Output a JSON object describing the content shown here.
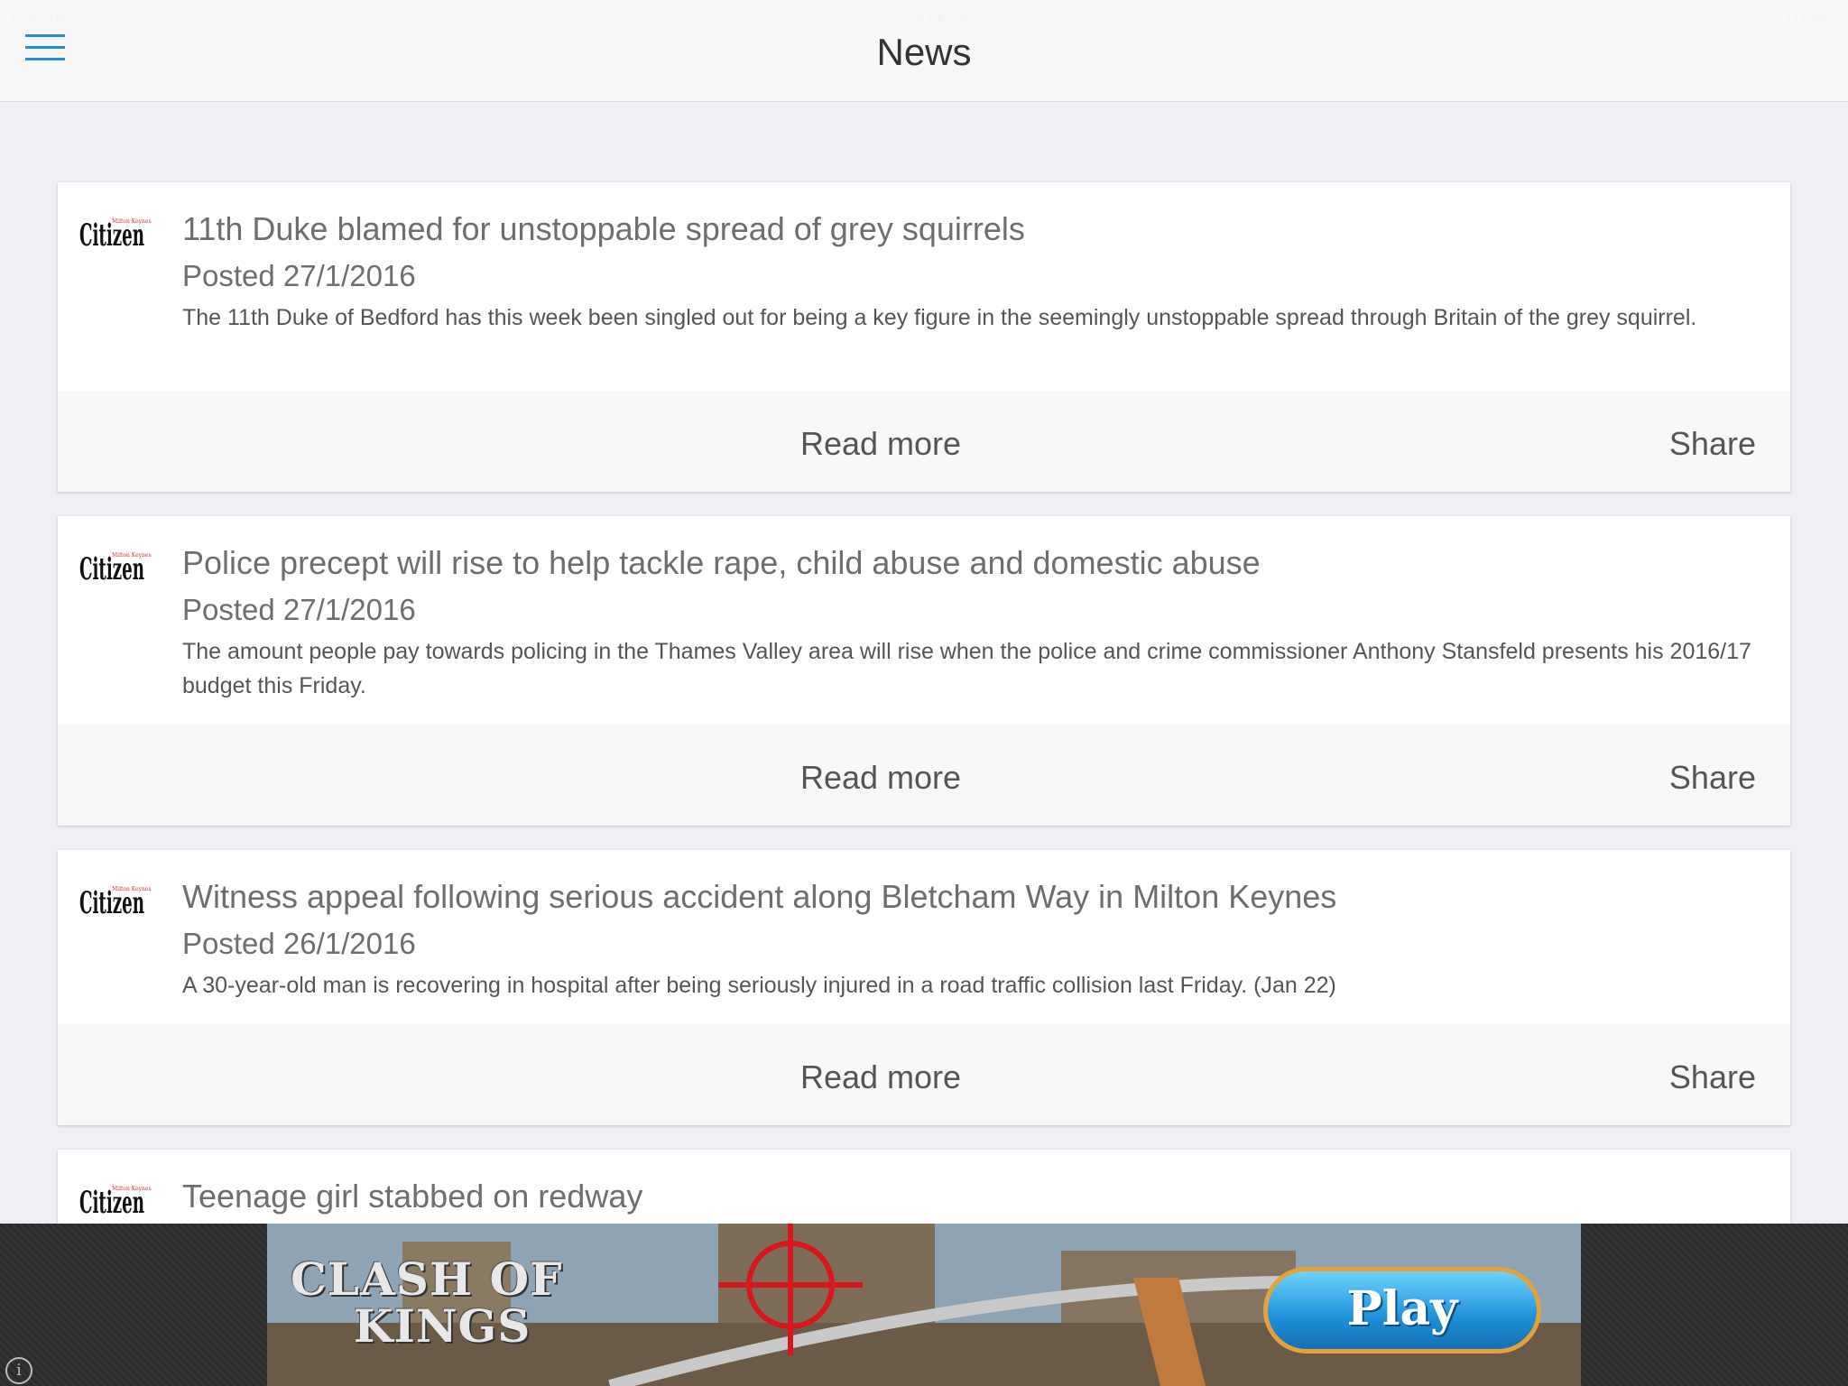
{
  "status_bar": {
    "carrier": "Carrier",
    "time": "12:20 PM",
    "battery": "100%"
  },
  "nav": {
    "title": "News"
  },
  "articles": [
    {
      "source": "Citizen",
      "source_tagline": "Milton Keynes",
      "title": "11th Duke blamed for unstoppable spread of grey squirrels",
      "posted": "Posted 27/1/2016",
      "summary": "The 11th Duke of Bedford has this week been singled out for being a key figure in the seemingly unstoppable spread through Britain of the grey squirrel.",
      "read_more": "Read more",
      "share": "Share"
    },
    {
      "source": "Citizen",
      "source_tagline": "Milton Keynes",
      "title": "Police precept will rise to help tackle rape, child abuse and domestic abuse",
      "posted": "Posted 27/1/2016",
      "summary": "The amount people pay towards policing in the Thames Valley area will rise when the police and crime commissioner Anthony Stansfeld presents his 2016/17 budget this Friday.",
      "read_more": "Read more",
      "share": "Share"
    },
    {
      "source": "Citizen",
      "source_tagline": "Milton Keynes",
      "title": "Witness appeal following serious accident along Bletcham Way in Milton Keynes",
      "posted": "Posted 26/1/2016",
      "summary": "A 30-year-old man is recovering in hospital after being seriously injured in a road traffic collision last Friday. (Jan 22)",
      "read_more": "Read more",
      "share": "Share"
    },
    {
      "source": "Citizen",
      "source_tagline": "Milton Keynes",
      "title": "Teenage girl stabbed on redway"
    }
  ],
  "ad": {
    "game_title_line1": "CLASH OF",
    "game_title_line2": "KINGS",
    "cta": "Play",
    "info": "i"
  },
  "colors": {
    "accent": "#2a8bd8",
    "background": "#efeff4",
    "card": "#ffffff",
    "actions_bg": "#f8f8f9"
  }
}
